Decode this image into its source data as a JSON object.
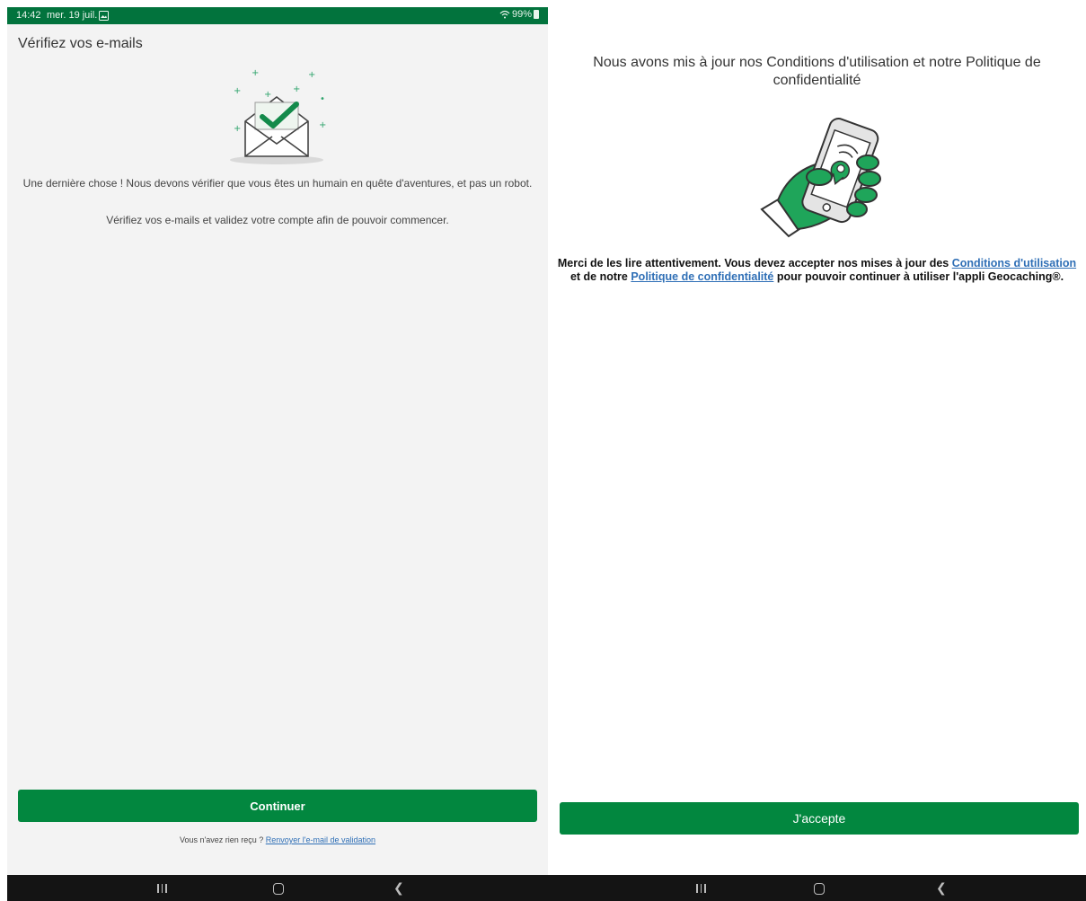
{
  "left": {
    "status": {
      "time": "14:42",
      "date": "mer. 19 juil.",
      "battery": "99%"
    },
    "title": "Vérifiez vos e-mails",
    "hero_icon": "envelope-check-icon",
    "paragraph1": "Une dernière chose ! Nous devons vérifier que vous êtes un humain en quête d'aventures, et pas un robot.",
    "paragraph2": "Vérifiez vos e-mails et validez votre compte afin de pouvoir commencer.",
    "continue_label": "Continuer",
    "resend_prefix": "Vous n'avez rien reçu ?",
    "resend_link": "Renvoyer l'e-mail de validation"
  },
  "right": {
    "heading": "Nous avons mis à jour nos Conditions d'utilisation et notre Politique de confidentialité",
    "hero_icon": "hand-phone-location-icon",
    "body_part1": "Merci de les lire attentivement. Vous devez accepter nos mises à jour des",
    "terms_link": "Conditions d'utilisation",
    "body_part2": "et de notre",
    "privacy_link": "Politique de confidentialité",
    "body_part3": "pour pouvoir continuer à utiliser l'appli Geocaching®.",
    "accept_label": "J'accepte"
  },
  "colors": {
    "brand_green": "#02873f",
    "status_green": "#02733d",
    "link_blue": "#2f6fb6"
  }
}
